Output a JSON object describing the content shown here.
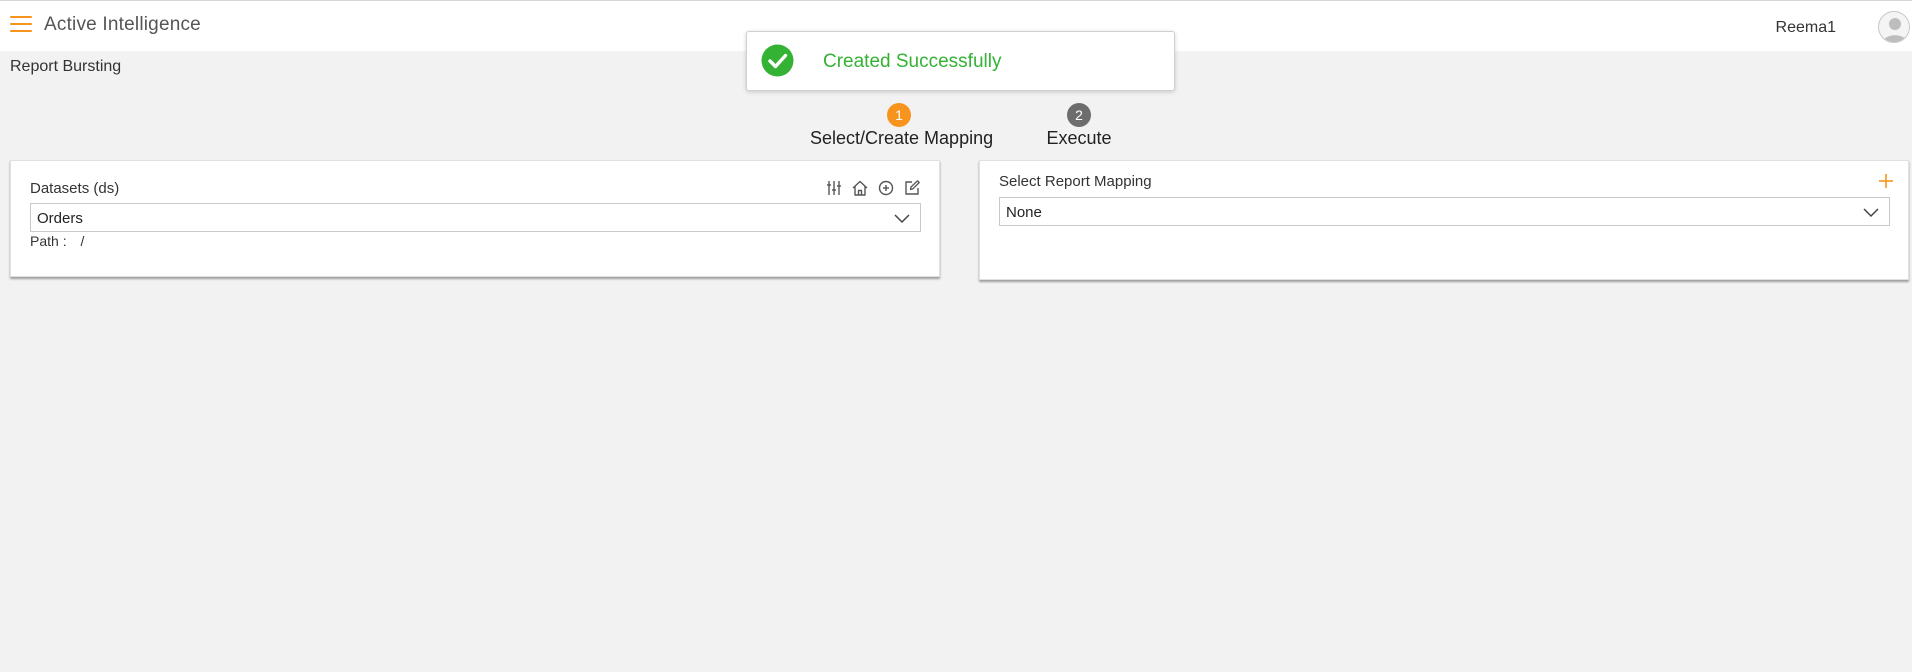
{
  "header": {
    "app_title": "Active Intelligence",
    "user_name": "Reema1",
    "accent_color": "#f7941d"
  },
  "page": {
    "title": "Report Bursting"
  },
  "toast": {
    "message": "Created Successfully",
    "icon": "check-circle-icon",
    "color": "#33b233"
  },
  "stepper": {
    "steps": [
      {
        "number": "1",
        "label": "Select/Create Mapping",
        "state": "active",
        "color": "#f7941d"
      },
      {
        "number": "2",
        "label": "Execute",
        "state": "inactive",
        "color": "#6d6d6d"
      }
    ]
  },
  "datasets_panel": {
    "label": "Datasets (ds)",
    "selected_value": "Orders",
    "path_label": "Path :",
    "path_value": "/",
    "toolbar_icons": [
      "sliders-icon",
      "home-icon",
      "add-circle-icon",
      "edit-icon"
    ]
  },
  "mapping_panel": {
    "label": "Select Report Mapping",
    "selected_value": "None",
    "add_icon": "plus-icon"
  }
}
